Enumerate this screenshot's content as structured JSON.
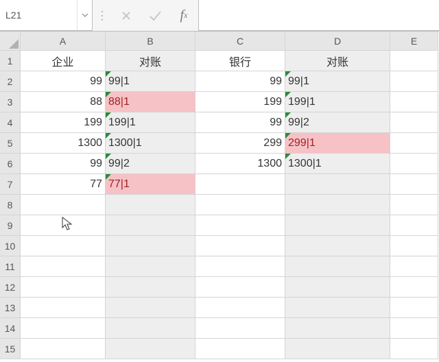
{
  "nameBox": "L21",
  "formulaBar": "",
  "columns": [
    "A",
    "B",
    "C",
    "D",
    "E"
  ],
  "rowCount": 15,
  "headers": {
    "A": "企业",
    "B": "对账",
    "C": "银行",
    "D": "对账"
  },
  "data": {
    "A": [
      "99",
      "88",
      "199",
      "1300",
      "99",
      "77"
    ],
    "B": [
      "99|1",
      "88|1",
      "199|1",
      "1300|1",
      "99|2",
      "77|1"
    ],
    "C": [
      "99",
      "199",
      "99",
      "299",
      "1300",
      ""
    ],
    "D": [
      "99|1",
      "199|1",
      "99|2",
      "299|1",
      "1300|1",
      ""
    ]
  },
  "shaded": {
    "B": true,
    "D": true
  },
  "pinkCells": [
    "B3",
    "B7",
    "D5"
  ],
  "tickCells": [
    "B2",
    "B3",
    "B4",
    "B5",
    "B6",
    "B7",
    "D2",
    "D3",
    "D4",
    "D5",
    "D6"
  ],
  "chart_data": {
    "type": "table",
    "title": "",
    "columns": [
      "企业",
      "对账",
      "银行",
      "对账"
    ],
    "rows": [
      [
        99,
        "99|1",
        99,
        "99|1"
      ],
      [
        88,
        "88|1",
        199,
        "199|1"
      ],
      [
        199,
        "199|1",
        99,
        "99|2"
      ],
      [
        1300,
        "1300|1",
        299,
        "299|1"
      ],
      [
        99,
        "99|2",
        1300,
        "1300|1"
      ],
      [
        77,
        "77|1",
        null,
        null
      ]
    ]
  }
}
